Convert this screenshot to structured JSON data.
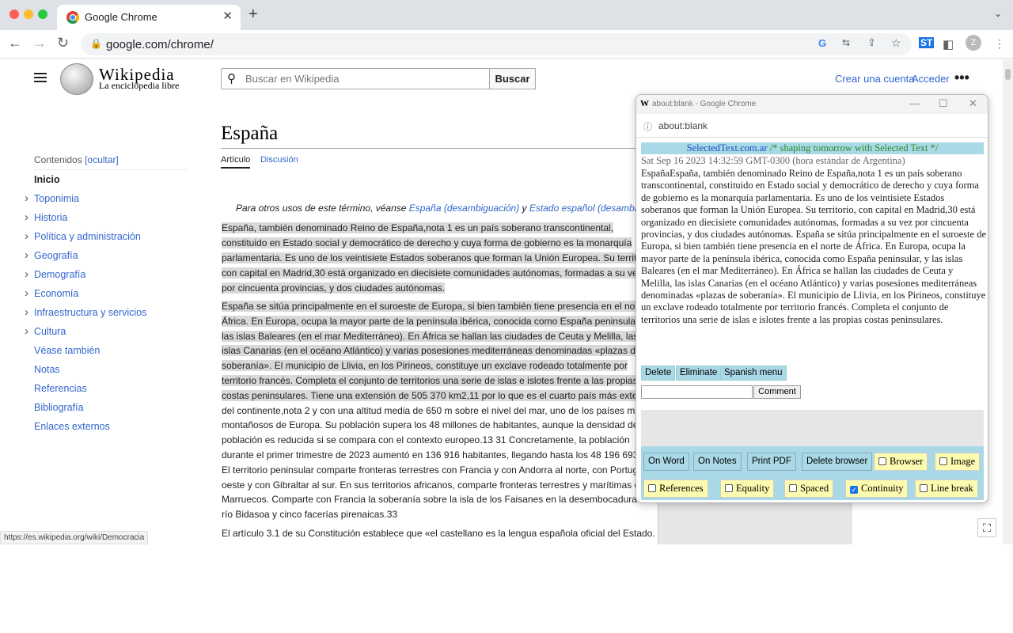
{
  "browser": {
    "tab_title": "Google Chrome",
    "url": "google.com/chrome/",
    "status_url": "https://es.wikipedia.org/wiki/Democracia"
  },
  "wiki": {
    "logo_title": "Wikipedia",
    "logo_subtitle": "La enciclopedia libre",
    "search_placeholder": "Buscar en Wikipedia",
    "search_button": "Buscar",
    "create_account": "Crear una cuenta",
    "login": "Acceder",
    "more": "•••",
    "toc_head": "Contenidos",
    "toc_hide": "[ocultar]",
    "toc": [
      {
        "label": "Inicio",
        "expand": false,
        "bold": true
      },
      {
        "label": "Toponimia",
        "expand": true
      },
      {
        "label": "Historia",
        "expand": true
      },
      {
        "label": "Política y administración",
        "expand": true
      },
      {
        "label": "Geografía",
        "expand": true
      },
      {
        "label": "Demografía",
        "expand": true
      },
      {
        "label": "Economía",
        "expand": true
      },
      {
        "label": "Infraestructura y servicios",
        "expand": true
      },
      {
        "label": "Cultura",
        "expand": true
      },
      {
        "label": "Véase también",
        "expand": false
      },
      {
        "label": "Notas",
        "expand": false
      },
      {
        "label": "Referencias",
        "expand": false
      },
      {
        "label": "Bibliografía",
        "expand": false
      },
      {
        "label": "Enlaces externos",
        "expand": false
      }
    ],
    "page_title": "España",
    "tab_article": "Artículo",
    "tab_discussion": "Discusión",
    "hatnote_a": "Para otros usos de este término, véanse ",
    "hatnote_link1": "España (desambiguación)",
    "hatnote_b": " y ",
    "hatnote_link2": "Estado español (desambigua",
    "p1": [
      "España, también denominado Reino de España,nota 1 es un país soberano transcontinental,",
      "constituido en Estado social y democrático de derecho y cuya forma de gobierno es la monarquía",
      "parlamentaria. Es uno de los veintisiete Estados soberanos que forman la Unión Europea. Su territori",
      "con capital en Madrid,30 está organizado en diecisiete comunidades autónomas, formadas a su vez",
      "por cincuenta provincias, y dos ciudades autónomas."
    ],
    "p2": [
      "España se sitúa principalmente en el suroeste de Europa, si bien también tiene presencia en el norte",
      "África. En Europa, ocupa la mayor parte de la península ibérica, conocida como España peninsular, y",
      "las islas Baleares (en el mar Mediterráneo). En África se hallan las ciudades de Ceuta y Melilla, las",
      "islas Canarias (en el océano Atlántico) y varias posesiones mediterráneas denominadas «plazas de",
      "soberanía». El municipio de Llivia, en los Pirineos, constituye un exclave rodeado totalmente por",
      "territorio francés. Completa el conjunto de territorios una serie de islas e islotes frente a las propias",
      "costas peninsulares. Tiene una extensión de 505 370 km2,11 por lo que es el cuarto país más extens",
      "del continente,nota 2 y con una altitud media de 650 m sobre el nivel del mar, uno de los países más",
      "montañosos de Europa. Su población supera los 48 millones de habitantes, aunque la densidad de",
      "población es reducida si se compara con el contexto europeo.13 31 Concretamente, la población",
      "durante el primer trimestre de 2023 aumentó en 136 916 habitantes, llegando hasta los 48 196 693.32",
      "El territorio peninsular comparte fronteras terrestres con Francia y con Andorra al norte, con Portugal",
      "oeste y con Gibraltar al sur. En sus territorios africanos, comparte fronteras terrestres y marítimas con",
      "Marruecos. Comparte con Francia la soberanía sobre la isla de los Faisanes en la desembocadura de",
      "río Bidasoa y cinco facerías pirenaicas.33"
    ],
    "p3": "El artículo 3.1 de su Constitución establece que «el castellano es la lengua española oficial del Estado."
  },
  "popup": {
    "window_title": "about:blank - Google Chrome",
    "url": "about:blank",
    "banner_site": "SelectedText.com.ar",
    "banner_slogan": " /* shaping tomorrow with Selected Text */",
    "date": "Sat Sep 16 2023 14:32:59 GMT-0300 (hora estándar de Argentina)",
    "text": "EspañaEspaña, también denominado Reino de España,nota 1 es un país soberano transcontinental, constituido en Estado social y democrático de derecho y cuya forma de gobierno es la monarquía parlamentaria. Es uno de los veintisiete Estados soberanos que forman la Unión Europea. Su territorio, con capital en Madrid,30 está organizado en diecisiete comunidades autónomas, formadas a su vez por cincuenta provincias, y dos ciudades autónomas. España se sitúa principalmente en el suroeste de Europa, si bien también tiene presencia en el norte de África. En Europa, ocupa la mayor parte de la península ibérica, conocida como España peninsular, y las islas Baleares (en el mar Mediterráneo). En África se hallan las ciudades de Ceuta y Melilla, las islas Canarias (en el océano Atlántico) y varias posesiones mediterráneas denominadas «plazas de soberanía». El municipio de Llivia, en los Pirineos, constituye un exclave rodeado totalmente por territorio francés. Completa el conjunto de territorios una serie de islas e islotes frente a las propias costas peninsulares.",
    "btn_delete": "Delete",
    "btn_eliminate": "Eliminate",
    "btn_spanish": "Spanish menu",
    "comment": "Comment",
    "opt_buttons": [
      "On Word",
      "On Notes",
      "Print PDF",
      "Delete browser"
    ],
    "checkboxes": [
      {
        "label": "Browser",
        "checked": false
      },
      {
        "label": "Image",
        "checked": false
      },
      {
        "label": "References",
        "checked": false
      },
      {
        "label": "Equality",
        "checked": false
      },
      {
        "label": "Spaced",
        "checked": false
      },
      {
        "label": "Continuity",
        "checked": true
      },
      {
        "label": "Line break",
        "checked": false
      }
    ]
  },
  "colors": {
    "link": "#3366cc",
    "highlight": "#d9d9d9",
    "panel": "#a9d8e6",
    "checkbox_bg": "#fdfbb0"
  }
}
